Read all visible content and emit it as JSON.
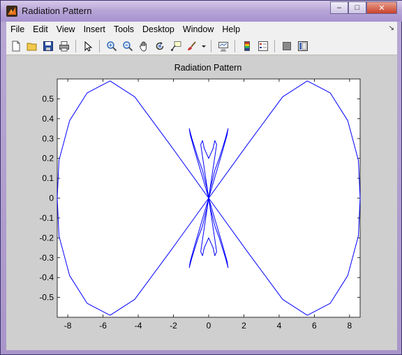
{
  "window": {
    "title": "Radiation Pattern",
    "caption_buttons": [
      "minimize",
      "maximize",
      "close"
    ]
  },
  "menubar": {
    "items": [
      "File",
      "Edit",
      "View",
      "Insert",
      "Tools",
      "Desktop",
      "Window",
      "Help"
    ]
  },
  "toolbar": {
    "buttons": [
      {
        "name": "new-figure-icon"
      },
      {
        "name": "open-file-icon"
      },
      {
        "name": "save-icon"
      },
      {
        "name": "print-icon"
      },
      {
        "name": "edit-plot-arrow-icon"
      },
      {
        "name": "zoom-in-icon"
      },
      {
        "name": "zoom-out-icon"
      },
      {
        "name": "pan-hand-icon"
      },
      {
        "name": "rotate-3d-icon"
      },
      {
        "name": "data-cursor-icon"
      },
      {
        "name": "brush-icon"
      },
      {
        "name": "link-plot-icon"
      },
      {
        "name": "insert-colorbar-icon"
      },
      {
        "name": "insert-legend-icon"
      },
      {
        "name": "hide-plot-tools-icon"
      },
      {
        "name": "show-plot-tools-icon"
      }
    ]
  },
  "chart_data": {
    "type": "line",
    "title": "Radiation Pattern",
    "xlabel": "",
    "ylabel": "",
    "xlim": [
      -8.6,
      8.6
    ],
    "ylim": [
      -0.6,
      0.6
    ],
    "x_ticks": [
      -8,
      -6,
      -4,
      -2,
      0,
      2,
      4,
      6,
      8
    ],
    "y_ticks": [
      -0.5,
      -0.4,
      -0.3,
      -0.2,
      -0.1,
      0,
      0.1,
      0.2,
      0.3,
      0.4,
      0.5
    ],
    "grid": false,
    "line_color": "#0000ff",
    "series": [
      {
        "x": [
          0,
          2.2,
          4.2,
          5.6,
          6.9,
          7.9,
          8.5,
          8.6,
          8.5,
          7.9,
          6.9,
          5.6,
          4.2,
          2.2,
          0,
          -2.2,
          -4.2,
          -5.6,
          -6.9,
          -7.9,
          -8.5,
          -8.6,
          -8.5,
          -7.9,
          -6.9,
          -5.6,
          -4.2,
          -2.2,
          0
        ],
        "y": [
          0,
          0.27,
          0.51,
          0.59,
          0.53,
          0.39,
          0.19,
          0,
          -0.19,
          -0.39,
          -0.53,
          -0.59,
          -0.51,
          -0.27,
          0,
          0.27,
          0.51,
          0.59,
          0.53,
          0.39,
          0.19,
          0,
          -0.19,
          -0.39,
          -0.53,
          -0.59,
          -0.51,
          -0.27,
          0
        ]
      },
      {
        "x": [
          0,
          -0.8,
          -1.05,
          -1.1,
          -0.95,
          -0.6,
          -0.35,
          -0.1,
          0.1,
          0.35,
          0.6,
          0.95,
          1.1,
          1.05,
          0.8,
          0,
          -0.8,
          -1.05,
          -1.1,
          -0.95,
          -0.6,
          -0.35,
          -0.1,
          0.1,
          0.35,
          0.6,
          0.95,
          1.1,
          1.05,
          0.8,
          0
        ],
        "y": [
          0,
          0.24,
          0.32,
          0.35,
          0.3,
          0.2,
          0.14,
          0.05,
          -0.05,
          -0.14,
          -0.2,
          -0.3,
          -0.35,
          -0.32,
          -0.24,
          0,
          -0.24,
          -0.32,
          -0.35,
          -0.3,
          -0.2,
          -0.14,
          -0.05,
          0.05,
          0.14,
          0.2,
          0.3,
          0.35,
          0.32,
          0.24,
          0
        ]
      },
      {
        "x": [
          0,
          -0.45,
          -0.35,
          -0.25,
          -0.15,
          0,
          0.15,
          0.25,
          0.35,
          0.45,
          0,
          -0.45,
          -0.35,
          -0.25,
          -0.15,
          0,
          0.15,
          0.25,
          0.35,
          0.45,
          0
        ],
        "y": [
          0,
          0.27,
          0.29,
          0.25,
          0.23,
          0.2,
          0.23,
          0.25,
          0.29,
          0.27,
          0,
          -0.27,
          -0.29,
          -0.25,
          -0.23,
          -0.2,
          -0.23,
          -0.25,
          -0.29,
          -0.27,
          0
        ]
      }
    ]
  }
}
